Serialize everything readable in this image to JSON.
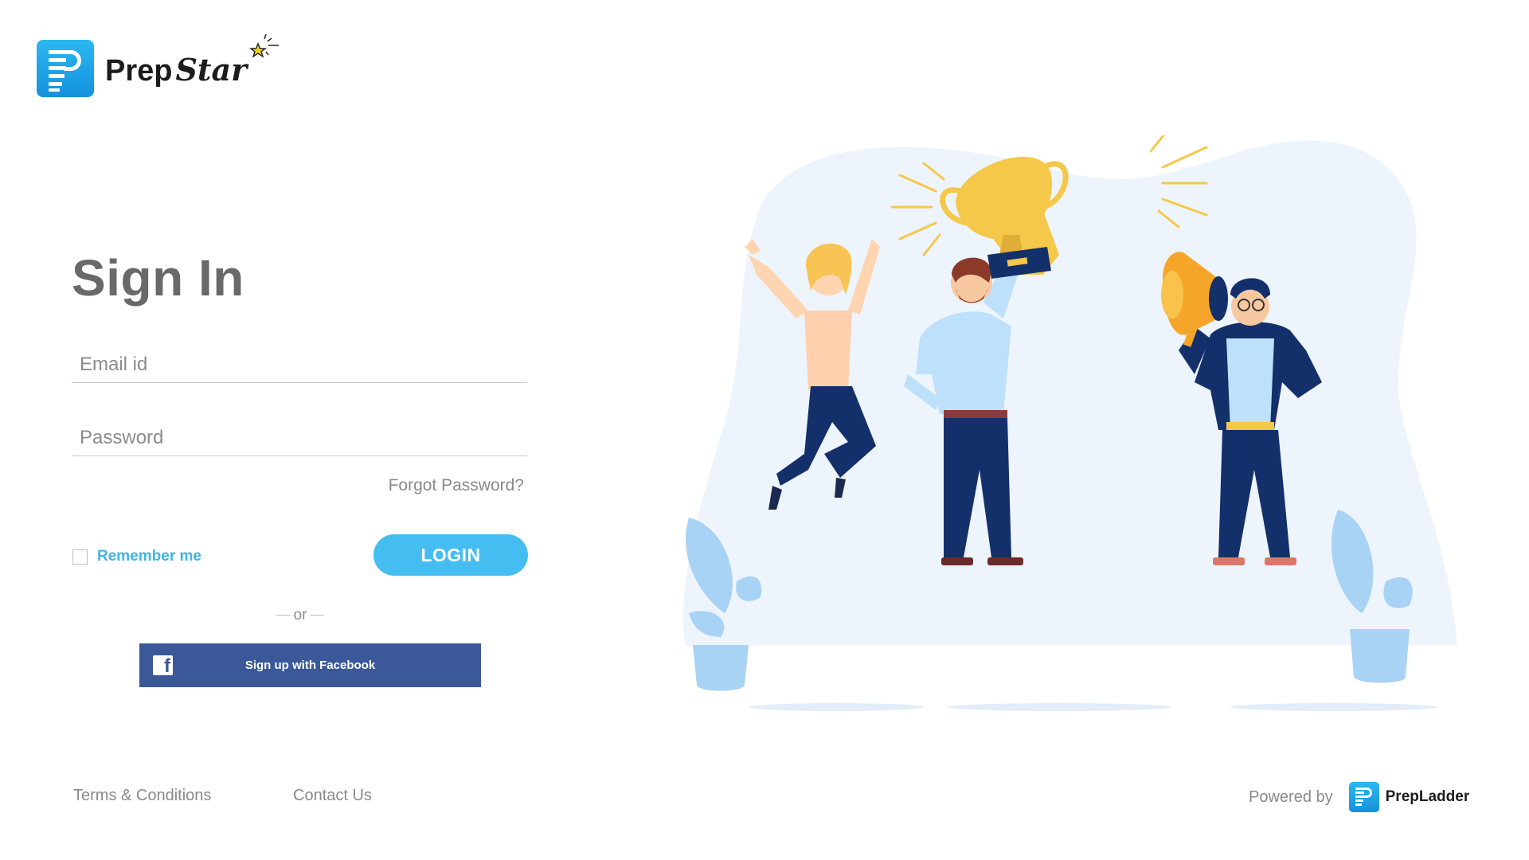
{
  "brand": {
    "name_bold": "Prep",
    "name_script": "Star",
    "accent": "#1da1e8"
  },
  "signin": {
    "title": "Sign In",
    "email_placeholder": "Email id",
    "password_placeholder": "Password",
    "forgot_label": "Forgot Password?",
    "remember_label": "Remember me",
    "remember_checked": false,
    "login_label": "LOGIN",
    "or_label": "or",
    "facebook_label": "Sign up with Facebook"
  },
  "footer": {
    "terms_label": "Terms & Conditions",
    "contact_label": "Contact Us",
    "powered_label": "Powered by",
    "powered_brand": "PrepLadder"
  },
  "colors": {
    "login_button": "#45bdf0",
    "facebook_button": "#3b5998",
    "remember_text": "#3fb4e6",
    "title": "#696969"
  },
  "icons": [
    "prepstar-logo-icon",
    "facebook-icon",
    "prepladder-logo-icon",
    "sparkle-star-icon"
  ]
}
